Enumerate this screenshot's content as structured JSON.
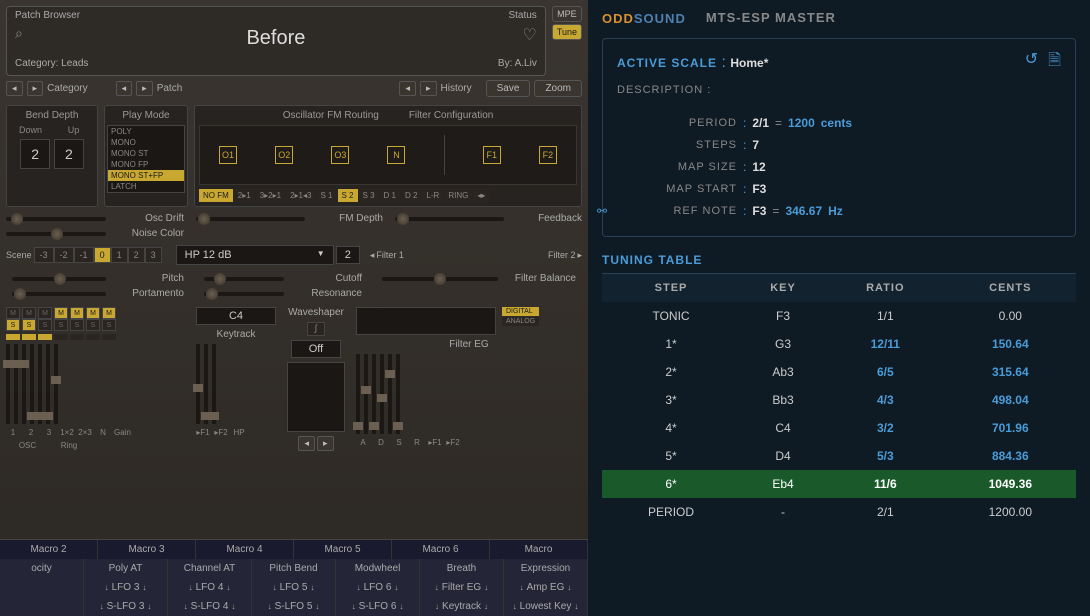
{
  "patchBrowser": {
    "title": "Patch Browser",
    "searchPlaceholder": "Search",
    "patchName": "Before",
    "category": "Category: Leads",
    "author": "By: A.Liv",
    "categoryLabel": "Category",
    "patchLabel": "Patch",
    "historyLabel": "History",
    "saveLabel": "Save",
    "zoomLabel": "Zoom"
  },
  "status": {
    "label": "Status",
    "mpe": "MPE",
    "tune": "Tune"
  },
  "sections": {
    "bendDepth": "Bend Depth",
    "playMode": "Play Mode",
    "fmRouting": "Oscillator FM Routing",
    "filterConfig": "Filter Configuration"
  },
  "bend": {
    "downLabel": "Down",
    "upLabel": "Up",
    "downVal": "2",
    "upVal": "2"
  },
  "playModes": [
    "POLY",
    "MONO",
    "MONO ST",
    "MONO FP",
    "MONO ST+FP",
    "LATCH"
  ],
  "playModeSelected": 4,
  "fmOsc": [
    "O1",
    "O2",
    "O3",
    "N"
  ],
  "fmFilters": [
    "F1",
    "F2"
  ],
  "fmTabs": [
    "NO FM",
    "2▸1",
    "3▸2▸1",
    "2▸1◂3",
    "S 1",
    "S 2",
    "S 3",
    "D 1",
    "D 2",
    "L-R",
    "RING",
    "◂▸"
  ],
  "fmTabActive": 0,
  "fmTabS2Active": 5,
  "sliders": {
    "oscDrift": "Osc Drift",
    "noiseColor": "Noise Color",
    "fmDepth": "FM Depth",
    "feedback": "Feedback",
    "pitch": "Pitch",
    "portamento": "Portamento",
    "cutoff": "Cutoff",
    "resonance": "Resonance",
    "filterBalance": "Filter Balance",
    "keytrack": "Keytrack",
    "waveshaper": "Waveshaper",
    "filterEG": "Filter EG"
  },
  "scene": {
    "label": "Scene",
    "buttons": [
      "-3",
      "-2",
      "-1",
      "0",
      "1",
      "2",
      "3"
    ],
    "active": 3
  },
  "filterDropdown": "HP 12 dB",
  "filterCount": "2",
  "filter1": "Filter 1",
  "filter2": "Filter 2",
  "keytrackDisplay": "C4",
  "wsOff": "Off",
  "daBtns": {
    "digital": "DIGITAL",
    "analog": "ANALOG"
  },
  "vLabels1": [
    "1",
    "2",
    "3",
    "1×2",
    "2×3",
    "N",
    "Gain"
  ],
  "vLabelsOsc": "OSC",
  "vLabelsRing": "Ring",
  "vLabels2": [
    "▸F1",
    "▸F2",
    "HP"
  ],
  "vLabels3": [
    "A",
    "D",
    "S",
    "R",
    "▸F1",
    "▸F2"
  ],
  "wsArrows": [
    "◂",
    "▸"
  ],
  "macros": [
    "Macro 2",
    "Macro 3",
    "Macro 4",
    "Macro 5",
    "Macro 6",
    "Macro"
  ],
  "modRow1": [
    "ocity",
    "Poly AT",
    "Channel AT",
    "Pitch Bend",
    "Modwheel",
    "Breath",
    "Expression"
  ],
  "modRow2": [
    "",
    "LFO 3",
    "LFO 4",
    "LFO 5",
    "LFO 6",
    "Filter EG",
    "Amp EG"
  ],
  "modRow3": [
    "",
    "S-LFO 3",
    "S-LFO 4",
    "S-LFO 5",
    "S-LFO 6",
    "Keytrack",
    "Lowest Key"
  ],
  "rp": {
    "brandOdd": "ODD",
    "brandSound": "SOUND",
    "title": "MTS-ESP MASTER",
    "activeScaleLabel": "ACTIVE SCALE",
    "activeScaleValue": "Home*",
    "descriptionLabel": "DESCRIPTION",
    "period": {
      "label": "PERIOD",
      "ratio": "2/1",
      "cents": "1200",
      "unit": "cents"
    },
    "steps": {
      "label": "STEPS",
      "value": "7"
    },
    "mapSize": {
      "label": "MAP SIZE",
      "value": "12"
    },
    "mapStart": {
      "label": "MAP START",
      "value": "F3"
    },
    "refNote": {
      "label": "REF NOTE",
      "key": "F3",
      "freq": "346.67",
      "unit": "Hz"
    },
    "tableHeader": "TUNING TABLE",
    "cols": {
      "step": "STEP",
      "key": "KEY",
      "ratio": "RATIO",
      "cents": "CENTS"
    },
    "rows": [
      {
        "step": "TONIC",
        "key": "F3",
        "ratio": "1/1",
        "cents": "0.00"
      },
      {
        "step": "1*",
        "key": "G3",
        "ratio": "12/11",
        "cents": "150.64"
      },
      {
        "step": "2*",
        "key": "Ab3",
        "ratio": "6/5",
        "cents": "315.64"
      },
      {
        "step": "3*",
        "key": "Bb3",
        "ratio": "4/3",
        "cents": "498.04"
      },
      {
        "step": "4*",
        "key": "C4",
        "ratio": "3/2",
        "cents": "701.96"
      },
      {
        "step": "5*",
        "key": "D4",
        "ratio": "5/3",
        "cents": "884.36"
      },
      {
        "step": "6*",
        "key": "Eb4",
        "ratio": "11/6",
        "cents": "1049.36"
      },
      {
        "step": "PERIOD",
        "key": "-",
        "ratio": "2/1",
        "cents": "1200.00"
      }
    ],
    "highlightRow": 6
  }
}
